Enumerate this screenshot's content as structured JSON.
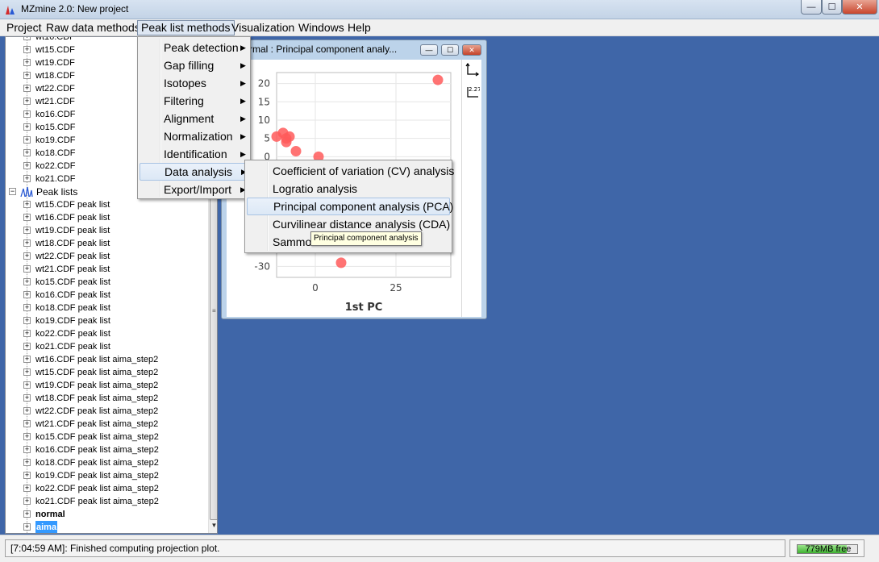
{
  "window": {
    "title": "MZmine 2.0: New project",
    "min_glyph": "—",
    "max_glyph": "☐",
    "close_glyph": "✕"
  },
  "menubar": [
    {
      "label": "Project",
      "active": false
    },
    {
      "label": "Raw data methods",
      "active": false
    },
    {
      "label": "Peak list methods",
      "active": true
    },
    {
      "label": "Visualization",
      "active": false
    },
    {
      "label": "Windows",
      "active": false
    },
    {
      "label": "Help",
      "active": false
    }
  ],
  "tree": {
    "top_partial": "wt16.CDF",
    "raw_files": [
      "wt15.CDF",
      "wt19.CDF",
      "wt18.CDF",
      "wt22.CDF",
      "wt21.CDF",
      "ko16.CDF",
      "ko15.CDF",
      "ko19.CDF",
      "ko18.CDF",
      "ko22.CDF",
      "ko21.CDF"
    ],
    "peak_lists_label": "Peak lists",
    "peak_lists": [
      "wt15.CDF peak list",
      "wt16.CDF peak list",
      "wt19.CDF peak list",
      "wt18.CDF peak list",
      "wt22.CDF peak list",
      "wt21.CDF peak list",
      "ko15.CDF peak list",
      "ko16.CDF peak list",
      "ko18.CDF peak list",
      "ko19.CDF peak list",
      "ko22.CDF peak list",
      "ko21.CDF peak list",
      "wt16.CDF peak list aima_step2",
      "wt15.CDF peak list aima_step2",
      "wt19.CDF peak list aima_step2",
      "wt18.CDF peak list aima_step2",
      "wt22.CDF peak list aima_step2",
      "wt21.CDF peak list aima_step2",
      "ko15.CDF peak list aima_step2",
      "ko16.CDF peak list aima_step2",
      "ko18.CDF peak list aima_step2",
      "ko19.CDF peak list aima_step2",
      "ko22.CDF peak list aima_step2",
      "ko21.CDF peak list aima_step2"
    ],
    "normal_label": "normal",
    "aima_label": "aima",
    "expander_collapsed": "+",
    "expander_expanded": "−",
    "selected": "aima"
  },
  "pca_window": {
    "title": "rmal : Principal component analy...",
    "toolbar": {
      "axes_icon": "axes-icon",
      "label_icon": "data-label-icon",
      "label_icon_text": "2.27"
    }
  },
  "main_menu": {
    "items": [
      {
        "label": "Peak detection",
        "submenu": true,
        "highlight": false
      },
      {
        "label": "Gap filling",
        "submenu": true,
        "highlight": false
      },
      {
        "label": "Isotopes",
        "submenu": true,
        "highlight": false
      },
      {
        "label": "Filtering",
        "submenu": true,
        "highlight": false
      },
      {
        "label": "Alignment",
        "submenu": true,
        "highlight": false
      },
      {
        "label": "Normalization",
        "submenu": true,
        "highlight": false
      },
      {
        "label": "Identification",
        "submenu": true,
        "highlight": false
      },
      {
        "label": "Data analysis",
        "submenu": true,
        "highlight": true
      },
      {
        "label": "Export/Import",
        "submenu": true,
        "highlight": false
      }
    ],
    "arrow_glyph": "▶"
  },
  "data_analysis_menu": {
    "items": [
      {
        "label": "Coefficient of variation (CV) analysis",
        "highlight": false
      },
      {
        "label": "Logratio analysis",
        "highlight": false
      },
      {
        "label": "Principal component analysis (PCA)",
        "highlight": true
      },
      {
        "label": "Curvilinear distance analysis (CDA)",
        "highlight": false
      },
      {
        "label": "Sammo",
        "highlight": false
      }
    ]
  },
  "tooltip": "Principal component analysis",
  "status": {
    "message": "[7:04:59 AM]: Finished computing projection plot.",
    "memory": "779MB free",
    "memory_free_fraction": 0.82
  },
  "chart_data": {
    "type": "scatter",
    "title": "",
    "xlabel": "1st PC",
    "ylabel": "",
    "xlim": [
      -12,
      42
    ],
    "ylim": [
      -33,
      23
    ],
    "x_ticks": [
      0,
      25
    ],
    "y_ticks": [
      20,
      15,
      10,
      5,
      0,
      -5,
      -25,
      -30
    ],
    "grid": true,
    "point_color": "#ff5a5a",
    "visible_regions": "partially covered by open menus",
    "series": [
      {
        "x": [
          38,
          -12,
          -10,
          -9,
          -9,
          -8,
          -6,
          1,
          8
        ],
        "y": [
          21,
          5.5,
          6.5,
          4,
          5,
          5.5,
          1.5,
          0,
          -29
        ]
      }
    ]
  }
}
